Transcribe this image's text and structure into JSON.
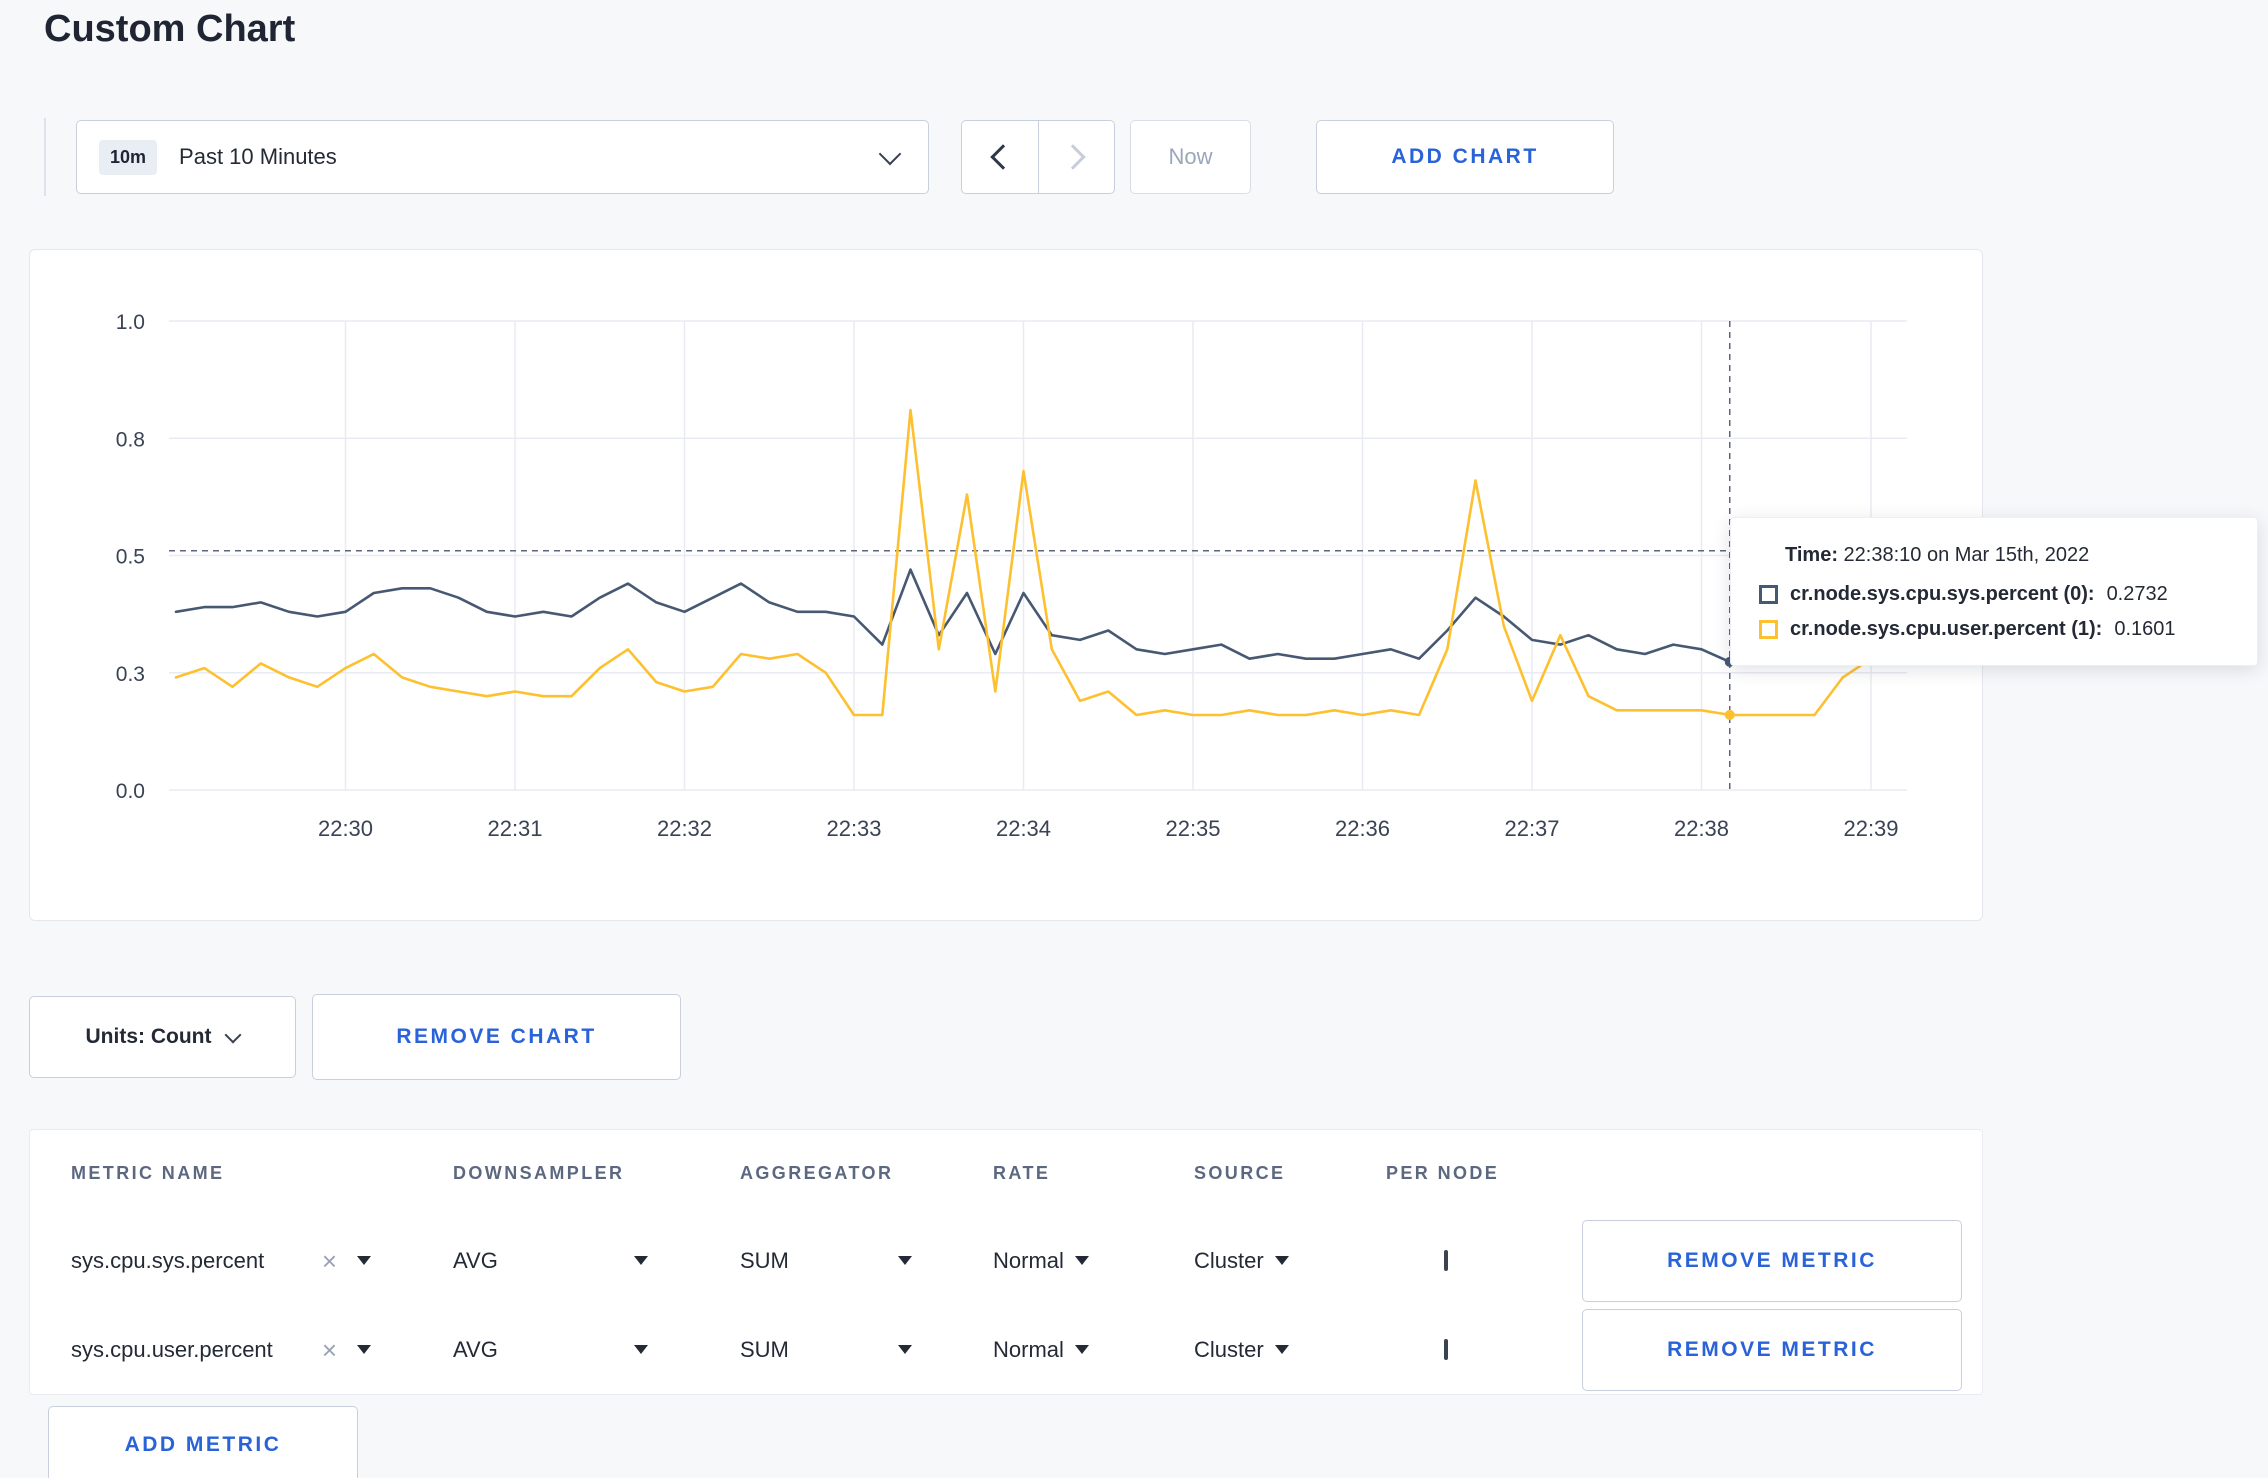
{
  "page": {
    "title": "Custom Chart"
  },
  "toolbar": {
    "range_badge": "10m",
    "range_label": "Past 10 Minutes",
    "now_label": "Now",
    "add_chart_label": "ADD CHART"
  },
  "chart_controls": {
    "units_label": "Units: Count",
    "remove_chart_label": "REMOVE CHART"
  },
  "tooltip": {
    "time_label": "Time:",
    "time_value": "22:38:10 on Mar 15th, 2022",
    "rows": [
      {
        "name": "cr.node.sys.cpu.sys.percent (0):",
        "value": "0.2732",
        "color": "#475872"
      },
      {
        "name": "cr.node.sys.cpu.user.percent (1):",
        "value": "0.1601",
        "color": "#fdc02f"
      }
    ]
  },
  "chart_data": {
    "type": "line",
    "title": "",
    "xlabel": "",
    "ylabel": "",
    "x_start": "22:29:00",
    "x_interval_seconds": 10,
    "x_tick_labels": [
      "22:30",
      "22:31",
      "22:32",
      "22:33",
      "22:34",
      "22:35",
      "22:36",
      "22:37",
      "22:38",
      "22:39"
    ],
    "y_ticks": [
      0,
      0.25,
      0.5,
      0.75,
      1.0
    ],
    "y_tick_labels": [
      "0.0",
      "0.3",
      "0.5",
      "0.8",
      "1.0"
    ],
    "ylim": [
      0,
      1
    ],
    "grid": true,
    "legend_position": "tooltip",
    "crosshair": {
      "x_index": 55,
      "x_time": "22:38:10",
      "hline_value": 0.51
    },
    "series": [
      {
        "name": "cr.node.sys.cpu.sys.percent",
        "color": "#475872",
        "values": [
          0.38,
          0.39,
          0.39,
          0.4,
          0.38,
          0.37,
          0.38,
          0.42,
          0.43,
          0.43,
          0.41,
          0.38,
          0.37,
          0.38,
          0.37,
          0.41,
          0.44,
          0.4,
          0.38,
          0.41,
          0.44,
          0.4,
          0.38,
          0.38,
          0.37,
          0.31,
          0.47,
          0.33,
          0.42,
          0.29,
          0.42,
          0.33,
          0.32,
          0.34,
          0.3,
          0.29,
          0.3,
          0.31,
          0.28,
          0.29,
          0.28,
          0.28,
          0.29,
          0.3,
          0.28,
          0.34,
          0.41,
          0.37,
          0.32,
          0.31,
          0.33,
          0.3,
          0.29,
          0.31,
          0.3,
          0.2732,
          0.3,
          0.32,
          0.3,
          0.3,
          0.31
        ]
      },
      {
        "name": "cr.node.sys.cpu.user.percent",
        "color": "#fdc02f",
        "values": [
          0.24,
          0.26,
          0.22,
          0.27,
          0.24,
          0.22,
          0.26,
          0.29,
          0.24,
          0.22,
          0.21,
          0.2,
          0.21,
          0.2,
          0.2,
          0.26,
          0.3,
          0.23,
          0.21,
          0.22,
          0.29,
          0.28,
          0.29,
          0.25,
          0.16,
          0.16,
          0.81,
          0.3,
          0.63,
          0.21,
          0.68,
          0.3,
          0.19,
          0.21,
          0.16,
          0.17,
          0.16,
          0.16,
          0.17,
          0.16,
          0.16,
          0.17,
          0.16,
          0.17,
          0.16,
          0.3,
          0.66,
          0.35,
          0.19,
          0.33,
          0.2,
          0.17,
          0.17,
          0.17,
          0.17,
          0.1601,
          0.16,
          0.16,
          0.16,
          0.24,
          0.28
        ]
      }
    ]
  },
  "metrics_table": {
    "headers": [
      "METRIC NAME",
      "DOWNSAMPLER",
      "AGGREGATOR",
      "RATE",
      "SOURCE",
      "PER NODE"
    ],
    "rows": [
      {
        "metric": "sys.cpu.sys.percent",
        "downsampler": "AVG",
        "aggregator": "SUM",
        "rate": "Normal",
        "source": "Cluster",
        "per_node_checked": false,
        "remove_label": "REMOVE METRIC"
      },
      {
        "metric": "sys.cpu.user.percent",
        "downsampler": "AVG",
        "aggregator": "SUM",
        "rate": "Normal",
        "source": "Cluster",
        "per_node_checked": false,
        "remove_label": "REMOVE METRIC"
      }
    ],
    "add_metric_label": "ADD METRIC"
  },
  "icons": {
    "clear": "×"
  },
  "colors": {
    "accent_blue": "#2962d9",
    "series_sys": "#475872",
    "series_user": "#fdc02f"
  }
}
